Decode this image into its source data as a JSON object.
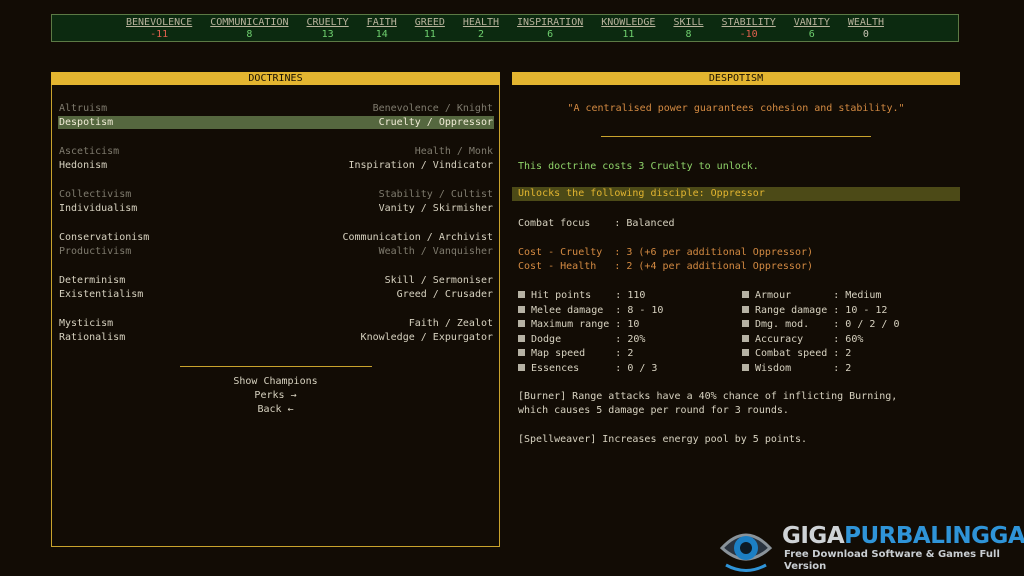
{
  "stats": [
    {
      "label": "BENEVOLENCE",
      "value": "-11",
      "tone": "neg"
    },
    {
      "label": "COMMUNICATION",
      "value": "8",
      "tone": "pos"
    },
    {
      "label": "CRUELTY",
      "value": "13",
      "tone": "pos"
    },
    {
      "label": "FAITH",
      "value": "14",
      "tone": "pos"
    },
    {
      "label": "GREED",
      "value": "11",
      "tone": "pos"
    },
    {
      "label": "HEALTH",
      "value": "2",
      "tone": "pos"
    },
    {
      "label": "INSPIRATION",
      "value": "6",
      "tone": "pos"
    },
    {
      "label": "KNOWLEDGE",
      "value": "11",
      "tone": "pos"
    },
    {
      "label": "SKILL",
      "value": "8",
      "tone": "pos"
    },
    {
      "label": "STABILITY",
      "value": "-10",
      "tone": "neg"
    },
    {
      "label": "VANITY",
      "value": "6",
      "tone": "pos"
    },
    {
      "label": "WEALTH",
      "value": "0",
      "tone": "zero"
    }
  ],
  "doctrines_panel": {
    "title": "DOCTRINES",
    "rows": [
      {
        "name": "Altruism",
        "detail": "Benevolence / Knight",
        "state": "dim"
      },
      {
        "name": "Despotism",
        "detail": "Cruelty / Oppressor",
        "state": "selected"
      },
      {
        "name": "Asceticism",
        "detail": "Health / Monk",
        "state": "dim"
      },
      {
        "name": "Hedonism",
        "detail": "Inspiration / Vindicator",
        "state": "bright"
      },
      {
        "name": "Collectivism",
        "detail": "Stability / Cultist",
        "state": "dim"
      },
      {
        "name": "Individualism",
        "detail": "Vanity / Skirmisher",
        "state": "bright"
      },
      {
        "name": "Conservationism",
        "detail": "Communication / Archivist",
        "state": "bright"
      },
      {
        "name": "Productivism",
        "detail": "Wealth / Vanquisher",
        "state": "dim"
      },
      {
        "name": "Determinism",
        "detail": "Skill / Sermoniser",
        "state": "bright"
      },
      {
        "name": "Existentialism",
        "detail": "Greed / Crusader",
        "state": "bright"
      },
      {
        "name": "Mysticism",
        "detail": "Faith / Zealot",
        "state": "bright"
      },
      {
        "name": "Rationalism",
        "detail": "Knowledge / Expurgator",
        "state": "bright"
      }
    ],
    "menu": {
      "show_champions": "Show Champions",
      "perks": "Perks →",
      "back": "Back ←"
    }
  },
  "detail_panel": {
    "title": "DESPOTISM",
    "quote": "\"A centralised power guarantees cohesion and stability.\"",
    "cost_line": "This doctrine costs 3 Cruelty to unlock.",
    "unlocks": "Unlocks the following disciple: Oppressor",
    "combat_focus": "Combat focus    : Balanced",
    "cost_cruelty": "Cost - Cruelty  : 3 (+6 per additional Oppressor)",
    "cost_health": "Cost - Health   : 2 (+4 per additional Oppressor)",
    "stats_left": [
      "Hit points    : 110",
      "Melee damage  : 8 - 10",
      "Maximum range : 10",
      "Dodge         : 20%",
      "Map speed     : 2",
      "Essences      : 0 / 3"
    ],
    "stats_right": [
      "Armour       : Medium",
      "Range damage : 10 - 12",
      "Dmg. mod.    : 0 / 2 / 0",
      "Accuracy     : 60%",
      "Combat speed : 2",
      "Wisdom       : 2"
    ],
    "burner_1": "[Burner] Range attacks have a 40% chance of inflicting Burning,",
    "burner_2": "which causes 5 damage per round for 3 rounds.",
    "spellweaver": "[Spellweaver] Increases energy pool by 5 points."
  },
  "watermark": {
    "brand_a": "GIGA",
    "brand_b": "PURBALINGGA",
    "tagline": "Free Download Software & Games Full Version"
  }
}
